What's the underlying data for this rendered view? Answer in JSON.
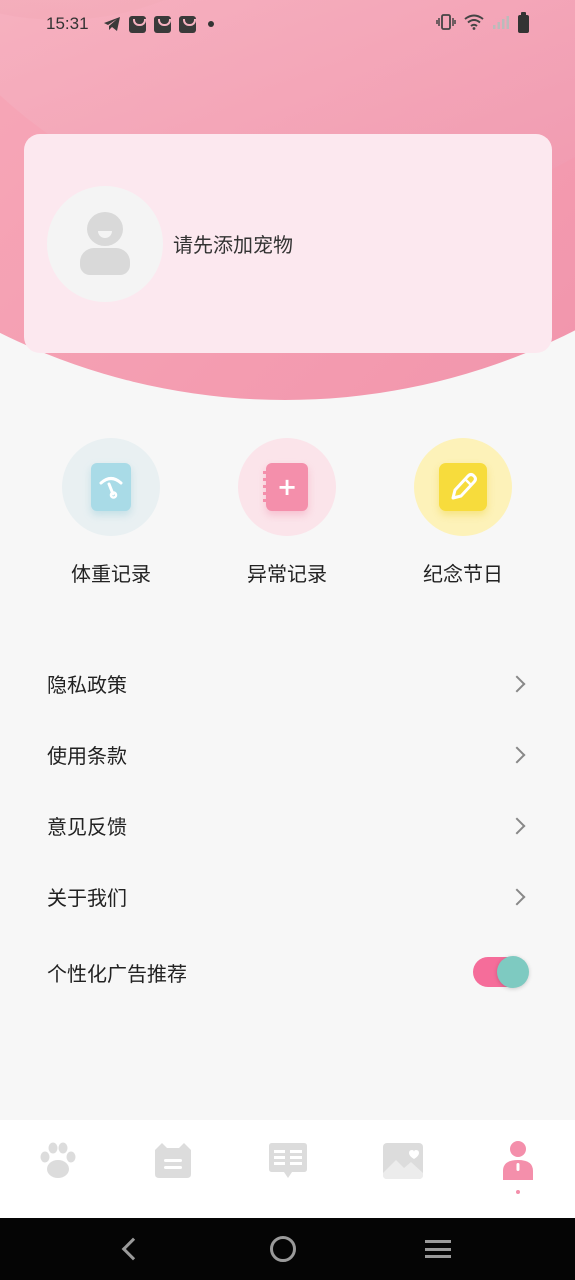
{
  "status_bar": {
    "time": "15:31"
  },
  "profile": {
    "prompt": "请先添加宠物"
  },
  "quick_actions": [
    {
      "label": "体重记录",
      "icon": "weight-record-icon"
    },
    {
      "label": "异常记录",
      "icon": "abnormal-record-icon"
    },
    {
      "label": "纪念节日",
      "icon": "memorial-day-icon"
    }
  ],
  "menu": {
    "privacy": "隐私政策",
    "terms": "使用条款",
    "feedback": "意见反馈",
    "about": "关于我们",
    "personalized_ads": "个性化广告推荐",
    "personalized_ads_enabled": true
  },
  "tabbar": {
    "tabs": [
      {
        "icon": "paw-icon",
        "active": false
      },
      {
        "icon": "cat-chat-icon",
        "active": false
      },
      {
        "icon": "article-icon",
        "active": false
      },
      {
        "icon": "album-icon",
        "active": false
      },
      {
        "icon": "profile-icon",
        "active": true
      }
    ]
  },
  "colors": {
    "accent": "#f48fab",
    "toggle_track": "#f56d9a",
    "toggle_knob": "#7ecac1"
  }
}
